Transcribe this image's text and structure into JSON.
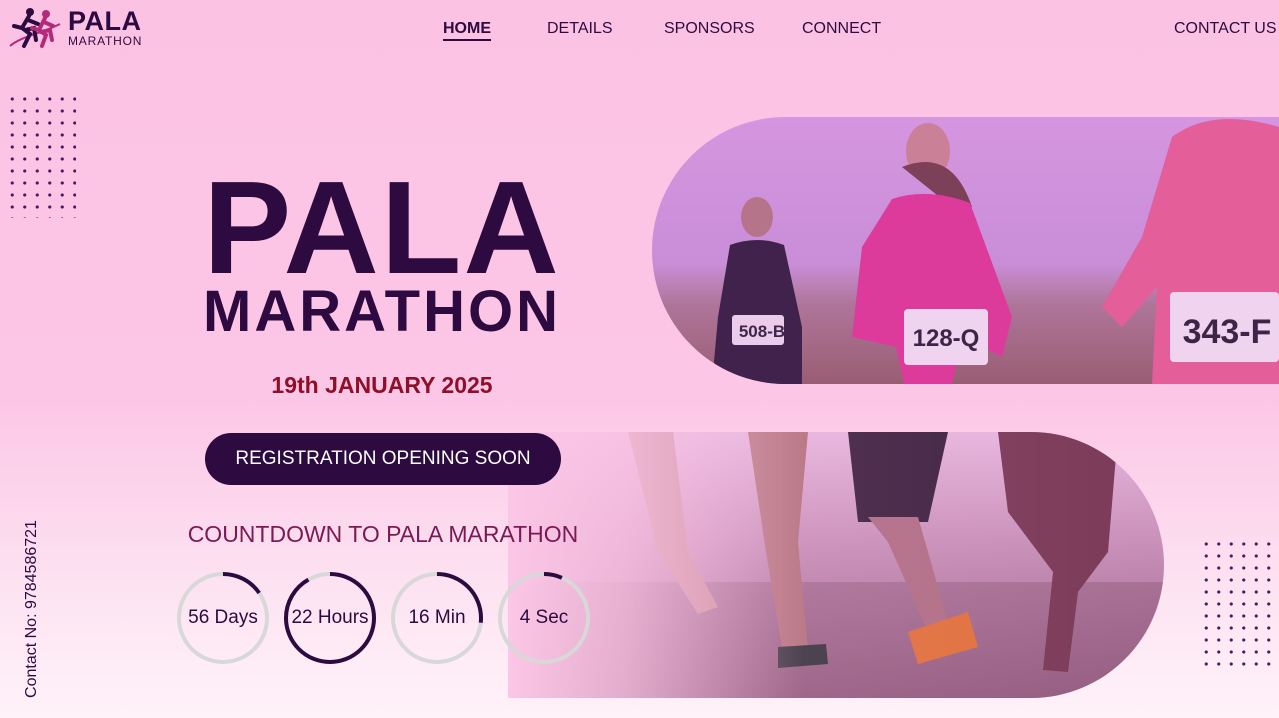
{
  "brand": {
    "name": "PALA",
    "sub": "MARATHON"
  },
  "nav": {
    "items": [
      "HOME",
      "DETAILS",
      "SPONSORS",
      "CONNECT"
    ],
    "active": "HOME",
    "contact": "CONTACT US"
  },
  "hero": {
    "title": "PALA",
    "subtitle": "MARATHON",
    "date": "19th JANUARY 2025",
    "button": "REGISTRATION OPENING SOON"
  },
  "countdown": {
    "title": "COUNTDOWN TO PALA MARATHON",
    "items": [
      {
        "label": "56 Days",
        "value": 56,
        "max": 365
      },
      {
        "label": "22 Hours",
        "value": 22,
        "max": 24
      },
      {
        "label": "16 Min",
        "value": 16,
        "max": 60
      },
      {
        "label": "4 Sec",
        "value": 4,
        "max": 60
      }
    ]
  },
  "side_contact": "Contact No: 9784586721",
  "bibs": [
    "508-B",
    "128-Q",
    "343-F"
  ],
  "colors": {
    "background": "#fcc2e4",
    "primary": "#2d0a3f",
    "date": "#8f0f2a",
    "countdown_title": "#7a1a55",
    "ring_track": "#d8d8d8"
  }
}
